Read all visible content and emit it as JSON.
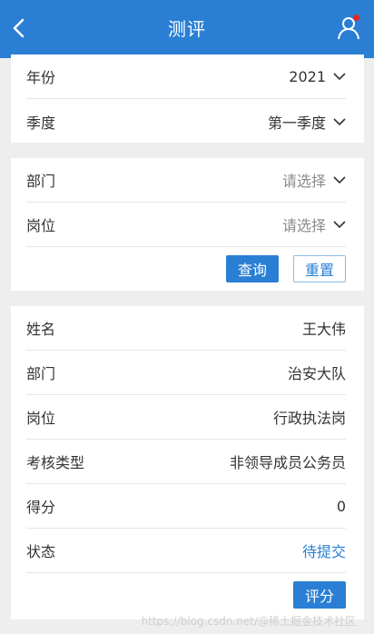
{
  "header": {
    "title": "测评",
    "back_icon": "chevron-left-icon",
    "user_icon": "user-icon",
    "bg": "#2a7fd4"
  },
  "filter_period": {
    "year": {
      "label": "年份",
      "value": "2021"
    },
    "quarter": {
      "label": "季度",
      "value": "第一季度"
    }
  },
  "filter_org": {
    "department": {
      "label": "部门",
      "value": "请选择"
    },
    "position": {
      "label": "岗位",
      "value": "请选择"
    },
    "query_label": "查询",
    "reset_label": "重置"
  },
  "result": {
    "name": {
      "label": "姓名",
      "value": "王大伟"
    },
    "department": {
      "label": "部门",
      "value": "治安大队"
    },
    "position": {
      "label": "岗位",
      "value": "行政执法岗"
    },
    "type": {
      "label": "考核类型",
      "value": "非领导成员公务员"
    },
    "score": {
      "label": "得分",
      "value": "0"
    },
    "status": {
      "label": "状态",
      "value": "待提交"
    },
    "score_button": "评分"
  },
  "watermark": "https://blog.csdn.net/@稀土掘金技术社区"
}
